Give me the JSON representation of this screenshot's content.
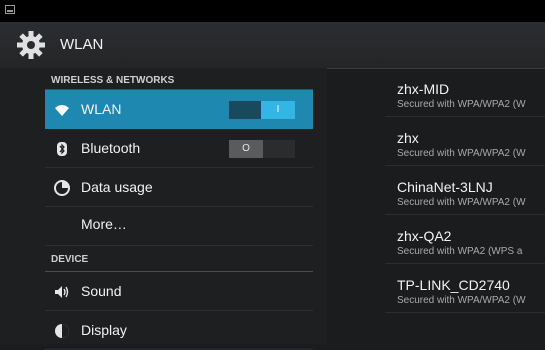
{
  "app": {
    "title": "WLAN"
  },
  "left": {
    "sections": [
      {
        "header": "WIRELESS & NETWORKS"
      },
      {
        "header": "DEVICE"
      }
    ],
    "items": [
      {
        "label": "WLAN",
        "icon": "wifi-icon",
        "toggle": "on",
        "toggle_label": "I"
      },
      {
        "label": "Bluetooth",
        "icon": "bluetooth-icon",
        "toggle": "off",
        "toggle_label": "O"
      },
      {
        "label": "Data usage",
        "icon": "data-usage-icon"
      },
      {
        "label": "More…"
      },
      {
        "label": "Sound",
        "icon": "speaker-icon"
      },
      {
        "label": "Display",
        "icon": "display-icon"
      }
    ]
  },
  "networks": [
    {
      "ssid": "zhx-MID",
      "security": "Secured with WPA/WPA2 (W"
    },
    {
      "ssid": "zhx",
      "security": "Secured with WPA/WPA2 (W"
    },
    {
      "ssid": "ChinaNet-3LNJ",
      "security": "Secured with WPA/WPA2 (W"
    },
    {
      "ssid": "zhx-QA2",
      "security": "Secured with WPA2 (WPS a"
    },
    {
      "ssid": "TP-LINK_CD2740",
      "security": "Secured with WPA/WPA2 (W"
    }
  ],
  "colors": {
    "accent": "#33b5e5",
    "selected": "#1e88b0"
  }
}
